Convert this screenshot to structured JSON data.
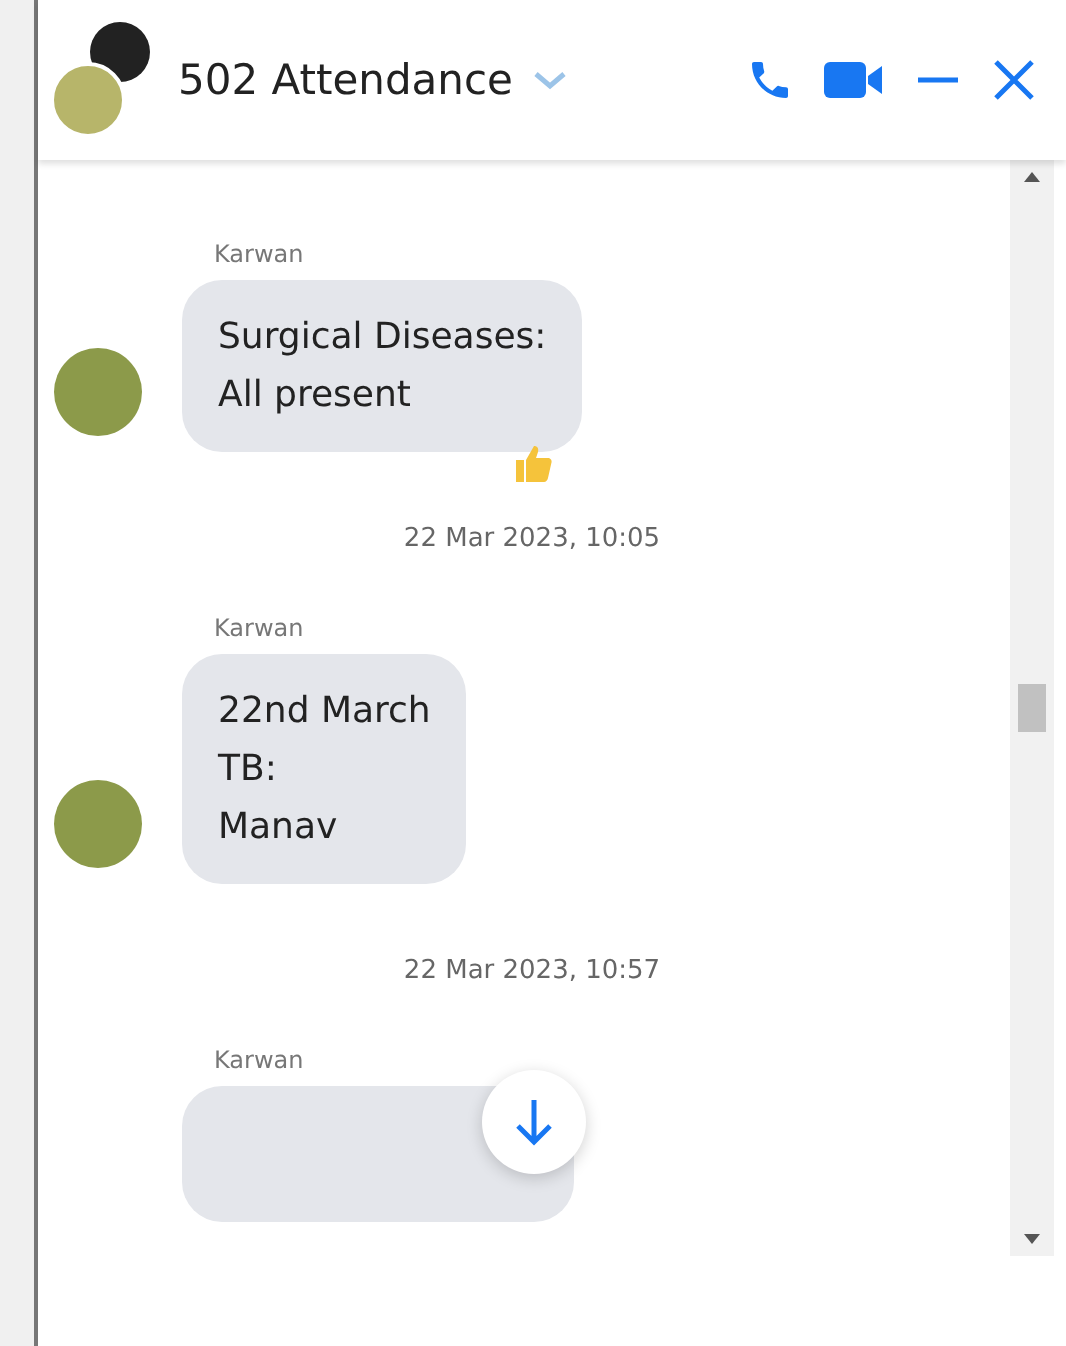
{
  "header": {
    "title": "502 Attendance"
  },
  "messages": [
    {
      "kind": "message",
      "sender": "Karwan",
      "lines": [
        "Surgical Diseases:",
        "All present"
      ],
      "reaction": true
    },
    {
      "kind": "timestamp",
      "text": "22 Mar 2023, 10:05"
    },
    {
      "kind": "message",
      "sender": "Karwan",
      "lines": [
        "22nd March",
        "TB:",
        "Manav"
      ],
      "reaction": false
    },
    {
      "kind": "timestamp",
      "text": "22 Mar 2023, 10:57"
    },
    {
      "kind": "message",
      "sender": "Karwan",
      "reaction": false
    }
  ]
}
